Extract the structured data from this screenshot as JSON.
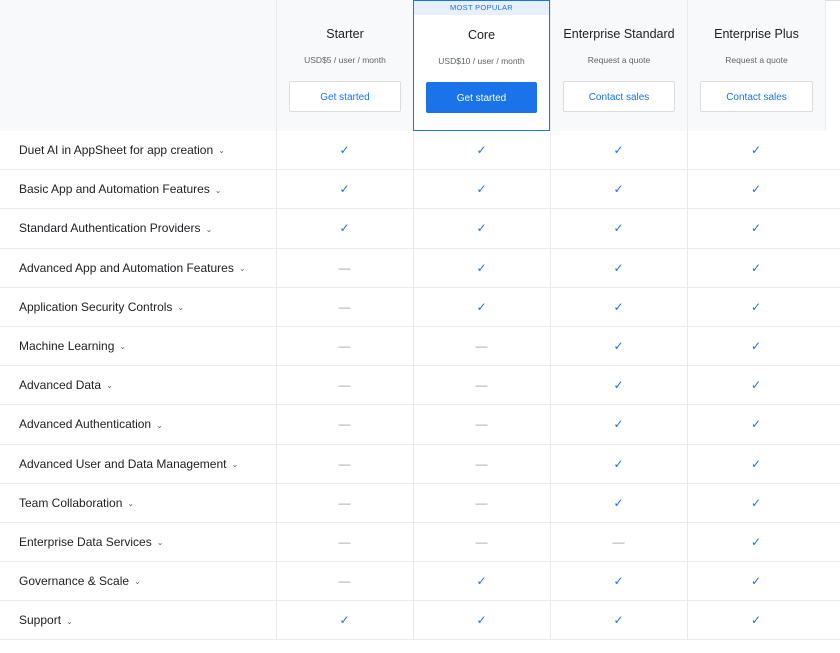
{
  "plans": [
    {
      "name": "Starter",
      "price": "USD$5 / user / month",
      "cta": "Get started",
      "popular": false
    },
    {
      "name": "Core",
      "price": "USD$10 / user / month",
      "cta": "Get started",
      "popular": true,
      "badge": "MOST POPULAR"
    },
    {
      "name": "Enterprise Standard",
      "price": "Request a quote",
      "cta": "Contact sales",
      "popular": false
    },
    {
      "name": "Enterprise Plus",
      "price": "Request a quote",
      "cta": "Contact sales",
      "popular": false
    }
  ],
  "features": [
    {
      "label": "Duet AI in AppSheet for app creation",
      "values": [
        true,
        true,
        true,
        true
      ]
    },
    {
      "label": "Basic App and Automation Features",
      "values": [
        true,
        true,
        true,
        true
      ]
    },
    {
      "label": "Standard Authentication Providers",
      "values": [
        true,
        true,
        true,
        true
      ]
    },
    {
      "label": "Advanced App and Automation Features",
      "values": [
        false,
        true,
        true,
        true
      ]
    },
    {
      "label": "Application Security Controls",
      "values": [
        false,
        true,
        true,
        true
      ]
    },
    {
      "label": "Machine Learning",
      "values": [
        false,
        false,
        true,
        true
      ]
    },
    {
      "label": "Advanced Data",
      "values": [
        false,
        false,
        true,
        true
      ]
    },
    {
      "label": "Advanced Authentication",
      "values": [
        false,
        false,
        true,
        true
      ]
    },
    {
      "label": "Advanced User and Data Management",
      "values": [
        false,
        false,
        true,
        true
      ]
    },
    {
      "label": "Team Collaboration",
      "values": [
        false,
        false,
        true,
        true
      ]
    },
    {
      "label": "Enterprise Data Services",
      "values": [
        false,
        false,
        false,
        true
      ]
    },
    {
      "label": "Governance & Scale",
      "values": [
        false,
        true,
        true,
        true
      ]
    },
    {
      "label": "Support",
      "values": [
        true,
        true,
        true,
        true
      ]
    }
  ],
  "symbols": {
    "included": "✓",
    "not_included": "—",
    "expand": "⌄"
  },
  "colors": {
    "accent": "#1a73e8",
    "header_bg": "#f8f9fa",
    "badge_bg": "#e8f0fe"
  }
}
